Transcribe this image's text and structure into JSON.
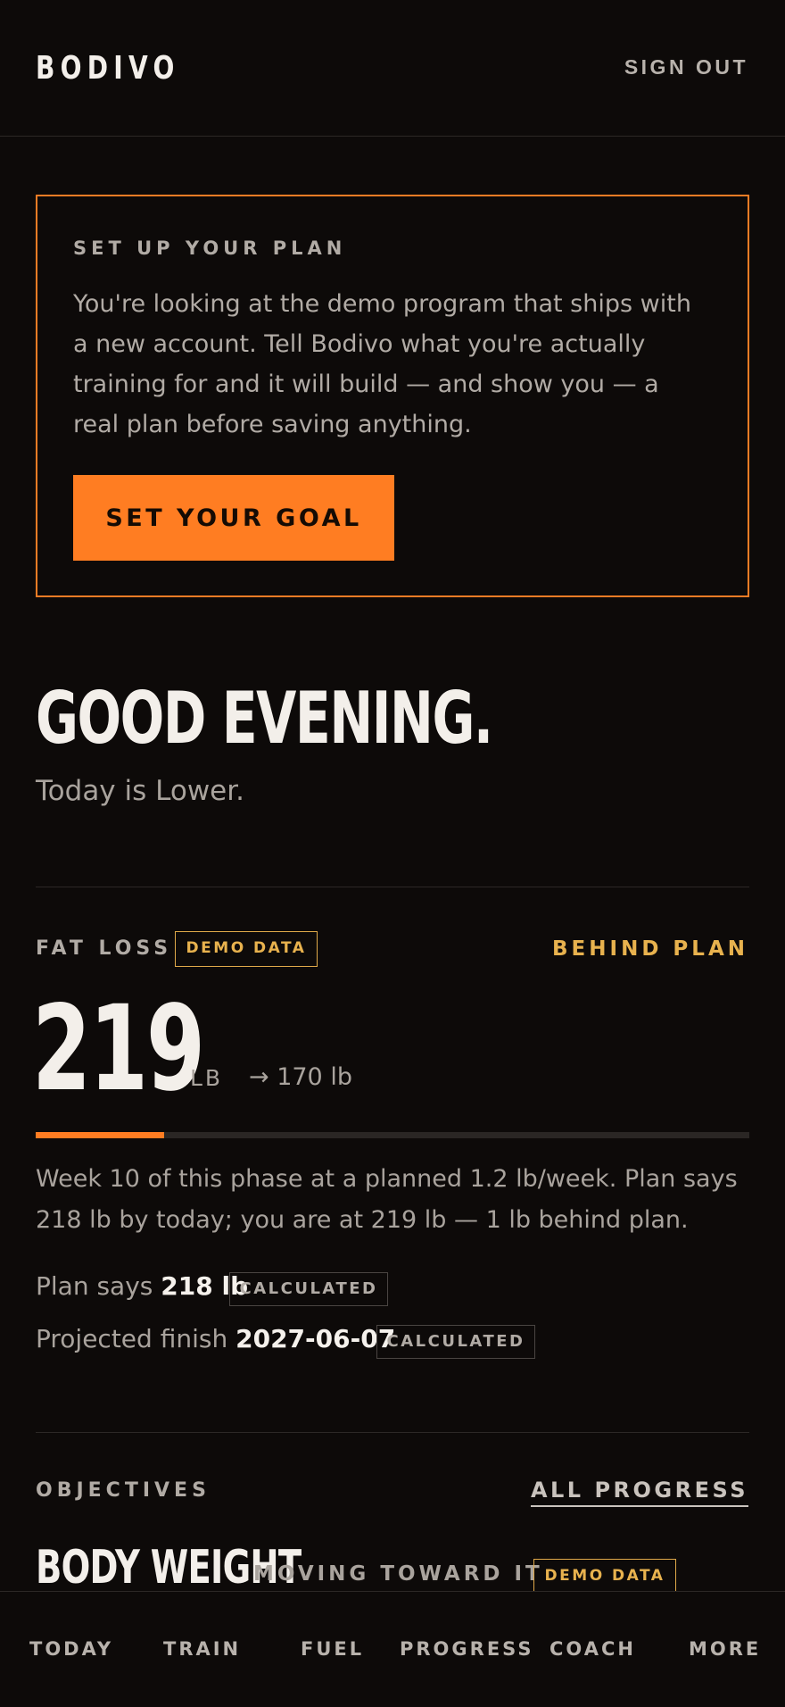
{
  "header": {
    "logo": "BODIVO",
    "sign_out": "SIGN OUT"
  },
  "setup": {
    "eyebrow": "SET UP YOUR PLAN",
    "body": "You're looking at the demo program that ships with a new account. Tell Bodivo what you're actually training for and it will build — and show you — a real plan before saving anything.",
    "button": "SET YOUR GOAL"
  },
  "greeting": {
    "title": "GOOD EVENING.",
    "subtitle": "Today is Lower."
  },
  "goal": {
    "label": "FAT LOSS",
    "demo_badge": "DEMO DATA",
    "status": "BEHIND PLAN",
    "current": "219",
    "unit": "LB",
    "target": "→ 170 lb",
    "progress_fraction": 0.18,
    "summary": "Week 10 of this phase at a planned 1.2 lb/week. Plan says 218 lb by today; you are at 219 lb — 1 lb behind plan.",
    "plan_label": "Plan says",
    "plan_value": "218 lb",
    "plan_badge": "CALCULATED",
    "finish_label": "Projected finish",
    "finish_value": "2027-06-07",
    "finish_badge": "CALCULATED"
  },
  "objectives": {
    "label": "OBJECTIVES",
    "link": "ALL PROGRESS",
    "item_title": "BODY WEIGHT",
    "item_status": "MOVING TOWARD IT",
    "item_badge": "DEMO DATA"
  },
  "nav": {
    "today": "TODAY",
    "train": "TRAIN",
    "fuel": "FUEL",
    "progress": "PROGRESS",
    "coach": "COACH",
    "more": "MORE"
  },
  "colors": {
    "accent": "#ff7d22",
    "warning": "#e8b24e",
    "background": "#0d0a09"
  }
}
